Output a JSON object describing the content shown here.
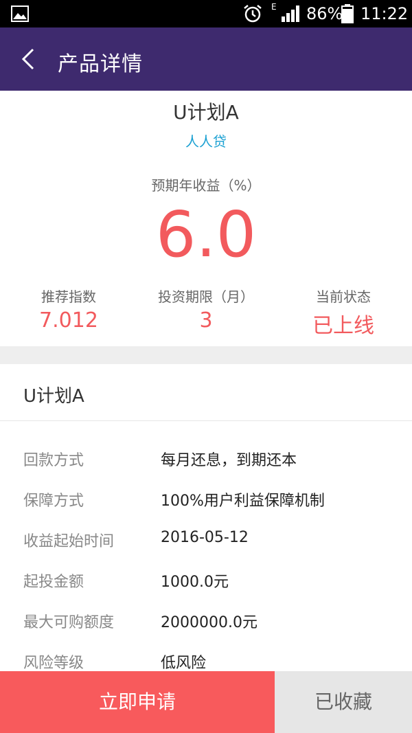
{
  "status_bar": {
    "network_type": "E",
    "battery_percent": "86%",
    "time": "11:22",
    "icons": [
      "image-icon",
      "alarm-icon",
      "signal-icon",
      "battery-icon"
    ]
  },
  "header": {
    "title": "产品详情",
    "back_icon": "back-chevron-icon",
    "background": "#3e2a6e"
  },
  "product": {
    "name": "U计划A",
    "platform": "人人贷",
    "yield_label": "预期年收益（%）",
    "yield_value": "6.0",
    "stats": [
      {
        "label": "推荐指数",
        "value": "7.012"
      },
      {
        "label": "投资期限（月）",
        "value": "3"
      },
      {
        "label": "当前状态",
        "value": "已上线"
      }
    ]
  },
  "details": {
    "title": "U计划A",
    "rows": [
      {
        "label": "回款方式",
        "value": "每月还息，到期还本"
      },
      {
        "label": "保障方式",
        "value": "100%用户利益保障机制"
      },
      {
        "label": "收益起始时间",
        "value": "2016-05-12"
      },
      {
        "label": "起投金额",
        "value": "1000.0元"
      },
      {
        "label": "最大可购额度",
        "value": "2000000.0元"
      },
      {
        "label": "风险等级",
        "value": "低风险"
      }
    ]
  },
  "actions": {
    "apply_label": "立即申请",
    "favorite_label": "已收藏"
  },
  "colors": {
    "accent_red": "#f25a5d",
    "platform_blue": "#1aa0d2",
    "apply_button": "#f85a5c",
    "favorite_button": "#e6e6e6"
  }
}
